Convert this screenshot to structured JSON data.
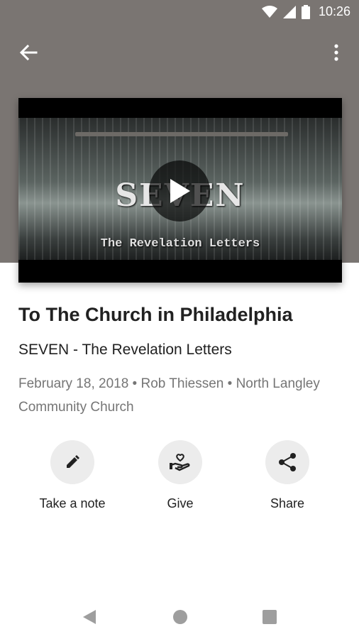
{
  "status_bar": {
    "time": "10:26",
    "icons": [
      "wifi-icon",
      "cell-signal-icon",
      "battery-icon"
    ]
  },
  "app_bar": {
    "back_icon": "arrow-left-icon",
    "menu_icon": "more-vert-icon"
  },
  "video": {
    "title_text": "SEVEN",
    "subtitle_text": "The Revelation Letters",
    "play_icon": "play-icon"
  },
  "sermon": {
    "title": "To The Church in Philadelphia",
    "series": "SEVEN - The Revelation Letters",
    "meta": "February 18, 2018 • Rob Thiessen • North Langley Community Church"
  },
  "actions": [
    {
      "label": "Take a note",
      "icon": "pencil-icon"
    },
    {
      "label": "Give",
      "icon": "give-heart-hand-icon"
    },
    {
      "label": "Share",
      "icon": "share-icon"
    }
  ],
  "nav_bar": {
    "back": "nav-back-icon",
    "home": "nav-home-icon",
    "recents": "nav-recents-icon"
  },
  "colors": {
    "hero_bg": "#7a7572",
    "text_primary": "#212121",
    "text_secondary": "#757575",
    "action_circle": "#ececec"
  }
}
